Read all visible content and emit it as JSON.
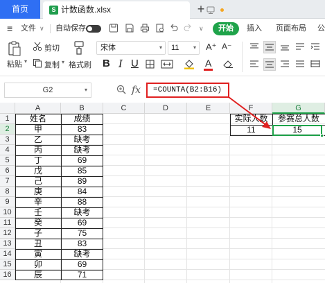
{
  "tabs": {
    "home_label": "首页",
    "file_label": "计数函数.xlsx",
    "file_icon_letter": "S",
    "add_label": "+"
  },
  "menubar": {
    "menu_glyph": "≡",
    "file_label": "文件",
    "chevron": "∨",
    "autosave_label": "自动保存",
    "start_label": "开始",
    "insert_label": "插入",
    "layout_label": "页面布局",
    "more_label": "公"
  },
  "ribbon": {
    "paste_label": "粘贴",
    "cut_label": "剪切",
    "copy_label": "复制",
    "format_painter_label": "格式刷",
    "font_name": "宋体",
    "font_size": "11",
    "bold": "B",
    "italic": "I",
    "underline": "U",
    "font_color_glyph": "A",
    "grow_font": "A⁺",
    "shrink_font": "A⁻"
  },
  "formula_bar": {
    "name_box": "G2",
    "fx_label": "fx",
    "formula": "=COUNTA(B2:B16)"
  },
  "grid": {
    "columns": [
      "A",
      "B",
      "C",
      "D",
      "E",
      "F",
      "G"
    ],
    "rows": [
      "1",
      "2",
      "3",
      "4",
      "5",
      "6",
      "7",
      "8",
      "9",
      "10",
      "11",
      "12",
      "13",
      "14",
      "15",
      "16"
    ],
    "table_header": {
      "name": "姓名",
      "score": "成绩"
    },
    "table_rows": [
      {
        "name": "甲",
        "score": "83"
      },
      {
        "name": "乙",
        "score": "缺考"
      },
      {
        "name": "丙",
        "score": "缺考"
      },
      {
        "name": "丁",
        "score": "69"
      },
      {
        "name": "戊",
        "score": "85"
      },
      {
        "name": "己",
        "score": "89"
      },
      {
        "name": "庚",
        "score": "84"
      },
      {
        "name": "辛",
        "score": "88"
      },
      {
        "name": "壬",
        "score": "缺考"
      },
      {
        "name": "癸",
        "score": "69"
      },
      {
        "name": "子",
        "score": "75"
      },
      {
        "name": "丑",
        "score": "83"
      },
      {
        "name": "寅",
        "score": "缺考"
      },
      {
        "name": "卯",
        "score": "69"
      },
      {
        "name": "辰",
        "score": "71"
      }
    ],
    "summary": {
      "f1": "实际人数",
      "g1": "参赛总人数",
      "f2": "11",
      "g2": "15"
    },
    "selected_cell": "G2",
    "accent_color": "#1fa34a",
    "highlight_color": "#e02020"
  }
}
